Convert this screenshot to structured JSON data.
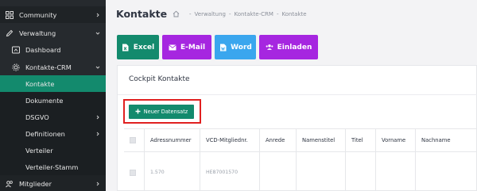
{
  "sidebar": {
    "items": [
      {
        "label": "Community",
        "icon": "grid-icon"
      },
      {
        "label": "Verwaltung",
        "icon": "pencil-icon"
      },
      {
        "label": "Dashboard",
        "icon": "dashboard-icon"
      },
      {
        "label": "Kontakte-CRM",
        "icon": "gear-icon"
      },
      {
        "label": "Kontakte"
      },
      {
        "label": "Dokumente"
      },
      {
        "label": "DSGVO"
      },
      {
        "label": "Definitionen"
      },
      {
        "label": "Verteiler"
      },
      {
        "label": "Verteiler-Stamm"
      },
      {
        "label": "Mitglieder",
        "icon": "users-icon"
      }
    ]
  },
  "header": {
    "title": "Kontakte",
    "breadcrumb": [
      "Verwaltung",
      "Kontakte-CRM",
      "Kontakte"
    ],
    "separator": "-"
  },
  "actions": {
    "excel": {
      "label": "Excel",
      "color": "#138a6d"
    },
    "email": {
      "label": "E-Mail",
      "color": "#a626e0"
    },
    "word": {
      "label": "Word",
      "color": "#3aa6ee"
    },
    "invite": {
      "label": "Einladen",
      "color": "#a626e0"
    }
  },
  "card": {
    "title": "Cockpit Kontakte",
    "new_record_label": "Neuer Datensatz"
  },
  "table": {
    "columns": [
      "",
      "Adressnummer",
      "VCD-Mitgliednr.",
      "Anrede",
      "Namenstitel",
      "Titel",
      "Vorname",
      "Nachname"
    ],
    "rows": [
      [
        "",
        "1.570",
        "HE87001570",
        "",
        "",
        "",
        "",
        ""
      ]
    ]
  }
}
